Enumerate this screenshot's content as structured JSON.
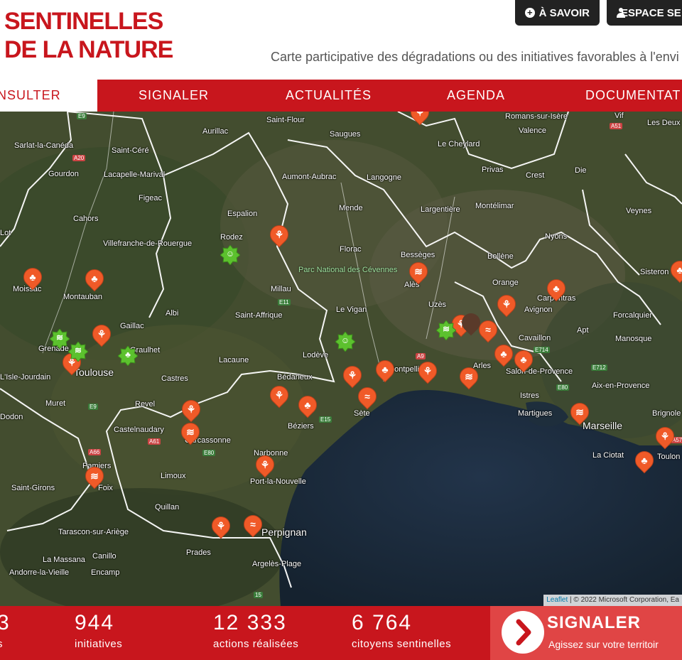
{
  "logo": {
    "line1": "SENTINELLES",
    "line2": "DE LA NATURE"
  },
  "tagline": "Carte participative des dégradations ou des initiatives favorables à l'envi",
  "top_buttons": {
    "about": "À SAVOIR",
    "space": "ESPACE SE"
  },
  "nav": {
    "items": [
      {
        "label": "NSULTER",
        "active": true
      },
      {
        "label": "SIGNALER",
        "active": false
      },
      {
        "label": "ACTUALITÉS",
        "active": false
      },
      {
        "label": "AGENDA",
        "active": false
      },
      {
        "label": "DOCUMENTATI",
        "active": false
      }
    ]
  },
  "map": {
    "places": [
      "Saint-Flour",
      "Romans-sur-Isère",
      "Vif",
      "Aurillac",
      "Saugues",
      "Valence",
      "Les Deux",
      "Sarlat-la-Canéda",
      "Saint-Céré",
      "Le Cheylard",
      "Gourdon",
      "Lacapelle-Marival",
      "Aumont-Aubrac",
      "Langogne",
      "Privas",
      "Crest",
      "Die",
      "Figeac",
      "Mende",
      "Largentière",
      "Montélimar",
      "Veynes",
      "Cahors",
      "Espalion",
      "Rodez",
      "Lot",
      "Nyons",
      "Villefranche-de-Rouergue",
      "Florac",
      "Bessèges",
      "Bollène",
      "Moissac",
      "Montauban",
      "Millau",
      "Alès",
      "Orange",
      "Carpentras",
      "Sisteron",
      "Albi",
      "Saint-Affrique",
      "Le Vigan",
      "Uzès",
      "Avignon",
      "Forcalquier",
      "Gaillac",
      "Cavaillon",
      "Apt",
      "Manosque",
      "Grenade",
      "Graulhet",
      "Lacaune",
      "Lodève",
      "Arles",
      "Salon-de-Provence",
      "L'Isle-Jourdain",
      "Toulouse",
      "Castres",
      "Bédarieux",
      "Montpellier",
      "Istres",
      "Aix-en-Provence",
      "Muret",
      "Revel",
      "Sète",
      "Martigues",
      "Brignole",
      "Dodon",
      "Castelnaudary",
      "Béziers",
      "Marseille",
      "Carcassonne",
      "Narbonne",
      "La Ciotat",
      "Toulon",
      "Pamiers",
      "Limoux",
      "Port-la-Nouvelle",
      "Saint-Girons",
      "Foix",
      "Quillan",
      "Tarascon-sur-Ariège",
      "Perpignan",
      "Prades",
      "Argelès-Plage",
      "La Massana",
      "Andorre-la-Vieille",
      "Encamp",
      "Canillo"
    ],
    "park": "Parc National des Cévennes",
    "roads": [
      "E9",
      "A20",
      "A51",
      "E11",
      "A9",
      "E714",
      "E712",
      "E80",
      "E9",
      "E15",
      "A61",
      "E80",
      "A66",
      "A57",
      "15"
    ],
    "attribution": {
      "leaflet": "Leaflet",
      "rest": " | © 2022 Microsoft Corporation, Ea"
    }
  },
  "stats": [
    {
      "number": "3",
      "label": "s"
    },
    {
      "number": "944",
      "label": "initiatives"
    },
    {
      "number": "12 333",
      "label": "actions réalisées"
    },
    {
      "number": "6 764",
      "label": "citoyens sentinelles"
    }
  ],
  "cta": {
    "title": "SIGNALER",
    "subtitle": "Agissez sur votre territoir"
  },
  "colors": {
    "brand_red": "#c8161d",
    "cta_red": "#e04545",
    "marker_orange": "#f05a28",
    "marker_green": "#5cc12e"
  }
}
